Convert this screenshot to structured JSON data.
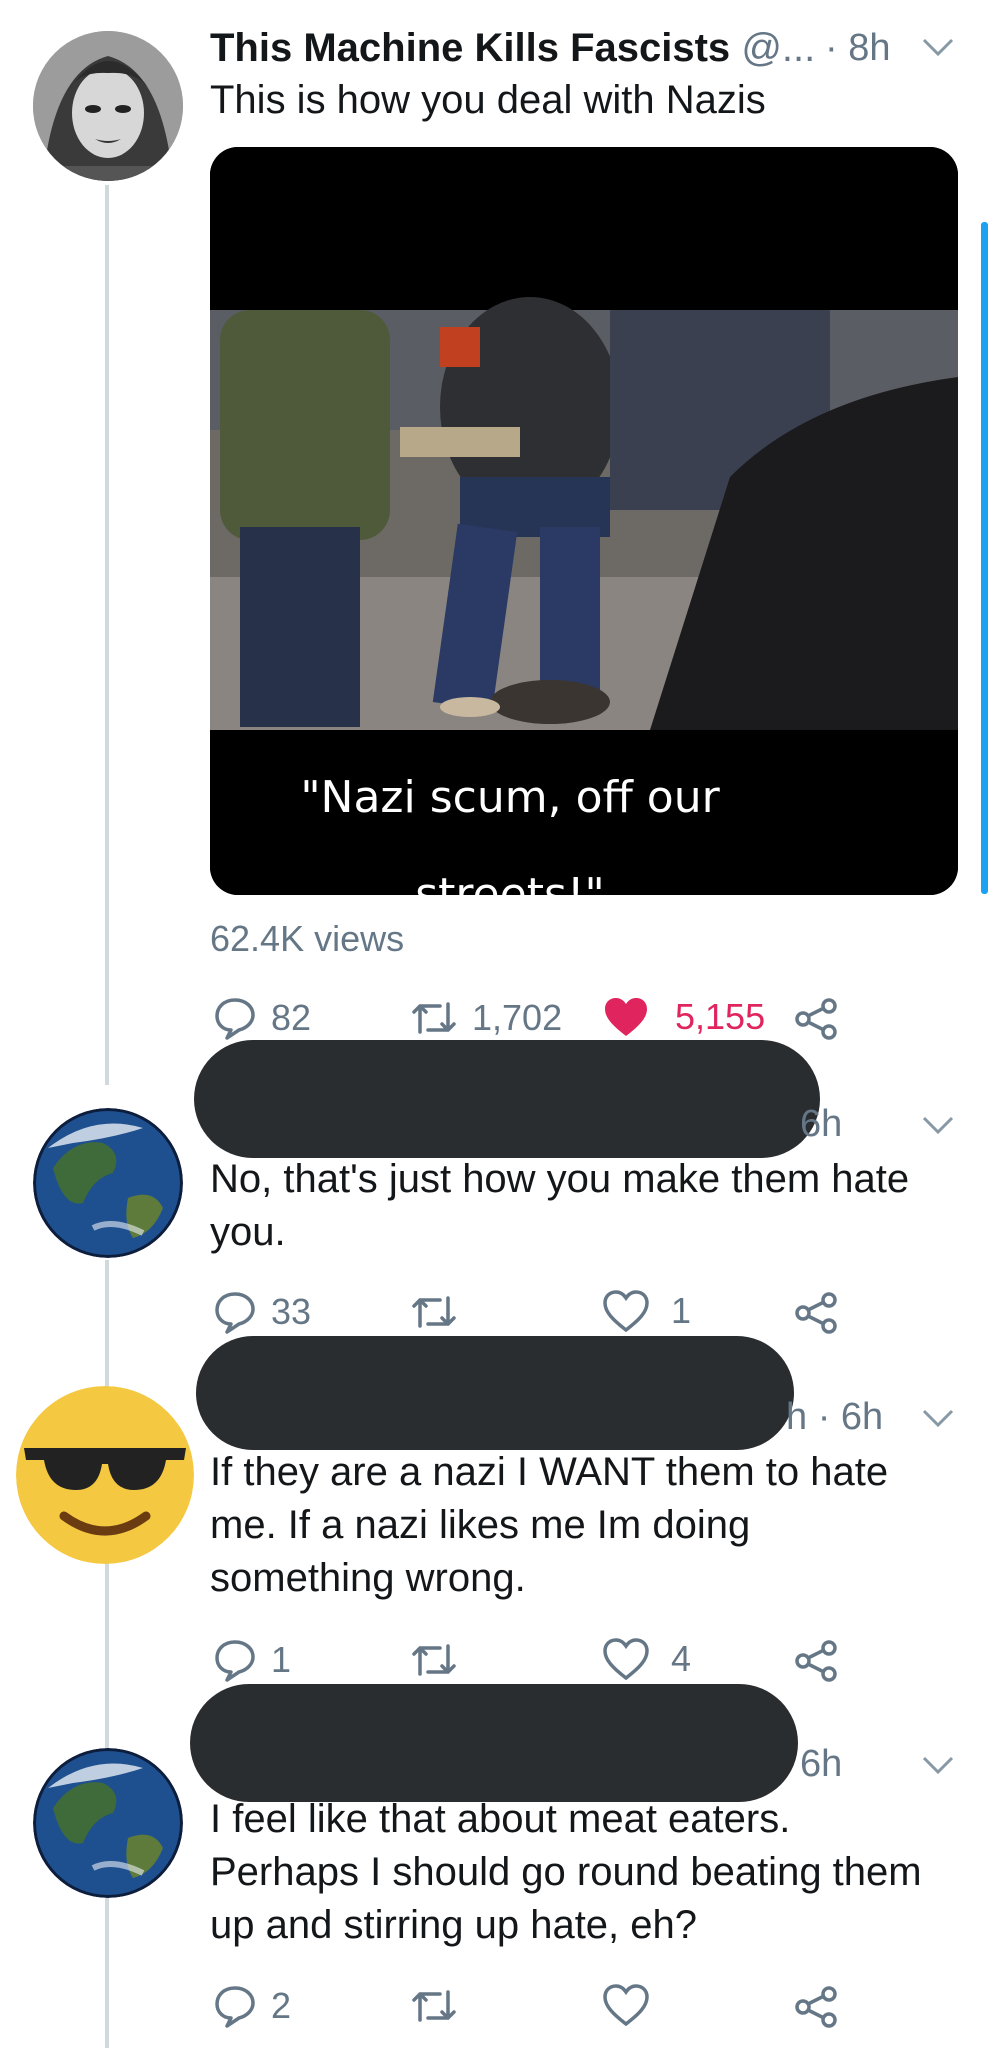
{
  "tweets": [
    {
      "name": "This Machine Kills Fascists",
      "handle": "@...",
      "time": "· 8h",
      "text": "This is how you deal with Nazis",
      "media_caption_line1": "\"Nazi scum, off our",
      "media_caption_line2": "streets!\"",
      "views": "62.4K views",
      "replies": "82",
      "retweets": "1,702",
      "likes": "5,155",
      "liked": true
    },
    {
      "time": "6h",
      "text": "No, that's just how you make them hate you.",
      "replies": "33",
      "retweets": "",
      "likes": "1"
    },
    {
      "time": "h · 6h",
      "text_line1": "If they are a nazi I WANT them to hate",
      "text_line2": "me. If a nazi likes me Im doing",
      "text_line3": "something wrong.",
      "replies": "1",
      "retweets": "",
      "likes": "4"
    },
    {
      "time": "6h",
      "text_line1": "I feel like that about meat eaters.",
      "text_line2": "Perhaps I should go round beating them",
      "text_line3": "up and stirring up hate, eh?",
      "replies": "2",
      "retweets": "",
      "likes": ""
    }
  ],
  "colors": {
    "accent": "#1da1f2",
    "like_active": "#e0245e",
    "secondary_text": "#657786",
    "redaction": "#2a2d30"
  },
  "icons": [
    "reply-icon",
    "retweet-icon",
    "like-icon",
    "share-icon",
    "chevron-down-icon"
  ]
}
